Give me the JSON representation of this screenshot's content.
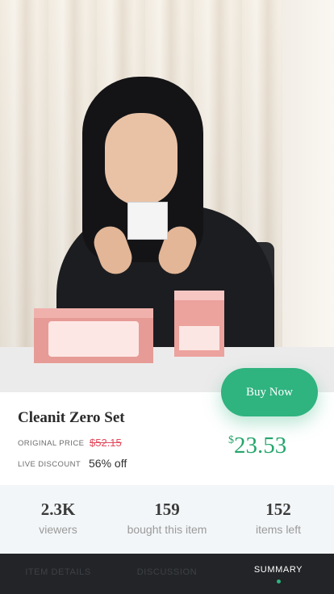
{
  "product": {
    "title": "Cleanit Zero Set",
    "original_price_label": "ORIGINAL PRICE",
    "original_price": "$52.15",
    "discount_label": "LIVE DISCOUNT",
    "discount": "56% off",
    "price_currency": "$",
    "price_amount": "23.53"
  },
  "actions": {
    "buy_now": "Buy Now"
  },
  "stats": [
    {
      "value": "2.3K",
      "label": "viewers"
    },
    {
      "value": "159",
      "label": "bought this item"
    },
    {
      "value": "152",
      "label": "items left"
    }
  ],
  "tabs": [
    {
      "label": "ITEM DETAILS",
      "active": false
    },
    {
      "label": "DISCUSSION",
      "active": false
    },
    {
      "label": "SUMMARY",
      "active": true
    }
  ],
  "colors": {
    "accent": "#2fb37f",
    "strike_red": "#e34a5d",
    "tabbar": "#222427"
  }
}
